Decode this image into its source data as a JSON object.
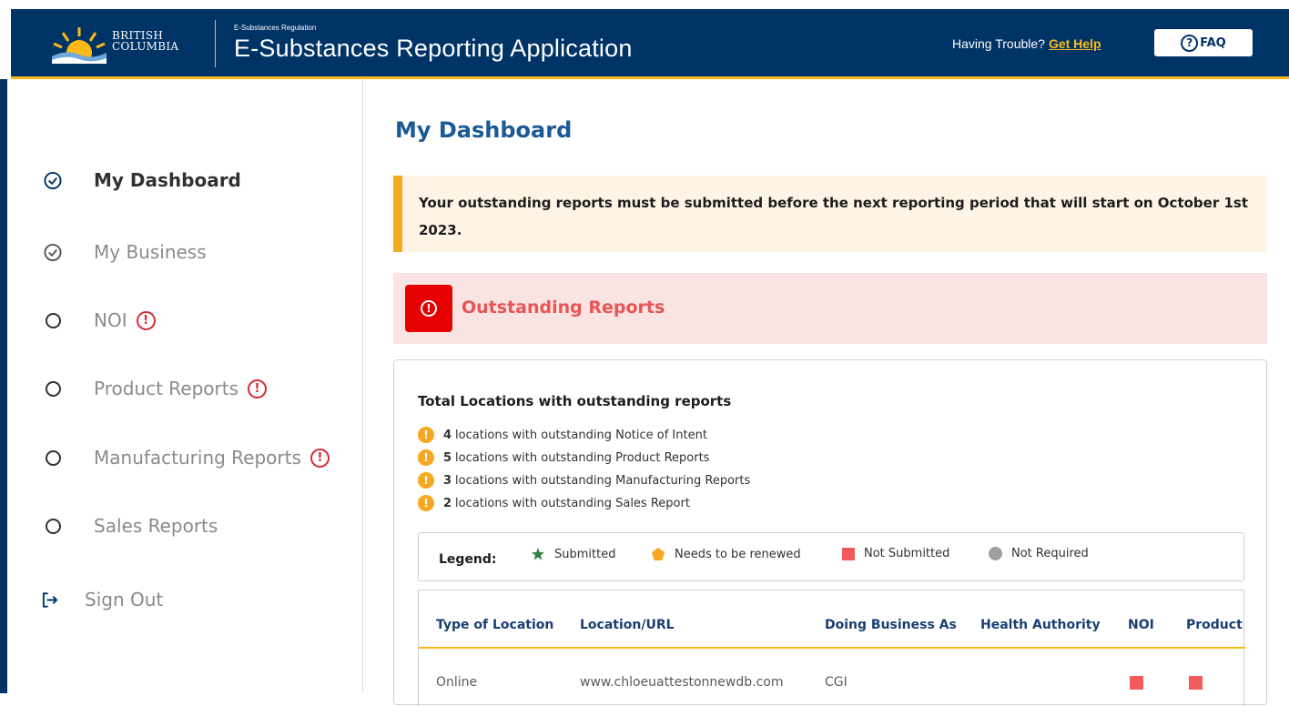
{
  "header": {
    "logo_line1": "BRITISH",
    "logo_line2": "COLUMBIA",
    "app_subtitle": "E-Substances Regulation",
    "app_title": "E-Substances Reporting Application",
    "trouble_text": "Having Trouble?",
    "help_link": "Get Help",
    "faq_label": "FAQ",
    "colors": {
      "navy": "#003366",
      "gold": "#fcba19"
    }
  },
  "sidebar": {
    "items": [
      {
        "label": "My Dashboard",
        "icon": "check-circle-icon",
        "active": true,
        "alert": false
      },
      {
        "label": "My Business",
        "icon": "check-circle-icon",
        "active": false,
        "alert": false
      },
      {
        "label": "NOI",
        "icon": "empty-circle-icon",
        "active": false,
        "alert": true
      },
      {
        "label": "Product Reports",
        "icon": "empty-circle-icon",
        "active": false,
        "alert": true
      },
      {
        "label": "Manufacturing Reports",
        "icon": "empty-circle-icon",
        "active": false,
        "alert": true
      },
      {
        "label": "Sales Reports",
        "icon": "empty-circle-icon",
        "active": false,
        "alert": false
      },
      {
        "label": "Sign Out",
        "icon": "sign-out-icon",
        "active": false,
        "alert": false
      }
    ],
    "alert_glyph": "!"
  },
  "main": {
    "title": "My Dashboard",
    "notice": "Your outstanding reports must be submitted before the next reporting period that will start on October 1st 2023.",
    "outstanding_title": "Outstanding Reports",
    "card_title": "Total Locations with outstanding reports",
    "summary": [
      {
        "count": "4",
        "text": "locations with outstanding Notice of Intent"
      },
      {
        "count": "5",
        "text": "locations with outstanding Product Reports"
      },
      {
        "count": "3",
        "text": "locations with outstanding Manufacturing Reports"
      },
      {
        "count": "2",
        "text": "locations with outstanding Sales Report"
      }
    ],
    "legend": {
      "label": "Legend:",
      "items": [
        {
          "label": "Submitted",
          "icon": "star-icon",
          "color": "#2e8540"
        },
        {
          "label": "Needs to be renewed",
          "icon": "pentagon-icon",
          "color": "#f6a821"
        },
        {
          "label": "Not Submitted",
          "icon": "square-icon",
          "color": "#f15b5b"
        },
        {
          "label": "Not Required",
          "icon": "circle-icon",
          "color": "#9e9e9e"
        }
      ]
    },
    "table": {
      "headers": [
        "Type of Location",
        "Location/URL",
        "Doing Business As",
        "Health Authority",
        "NOI",
        "Product"
      ],
      "rows": [
        {
          "type": "Online",
          "url": "www.chloeuattestonnewdb.com",
          "dba": "CGI",
          "health_authority": "",
          "noi": "not-submitted",
          "product": "not-submitted"
        }
      ]
    }
  }
}
